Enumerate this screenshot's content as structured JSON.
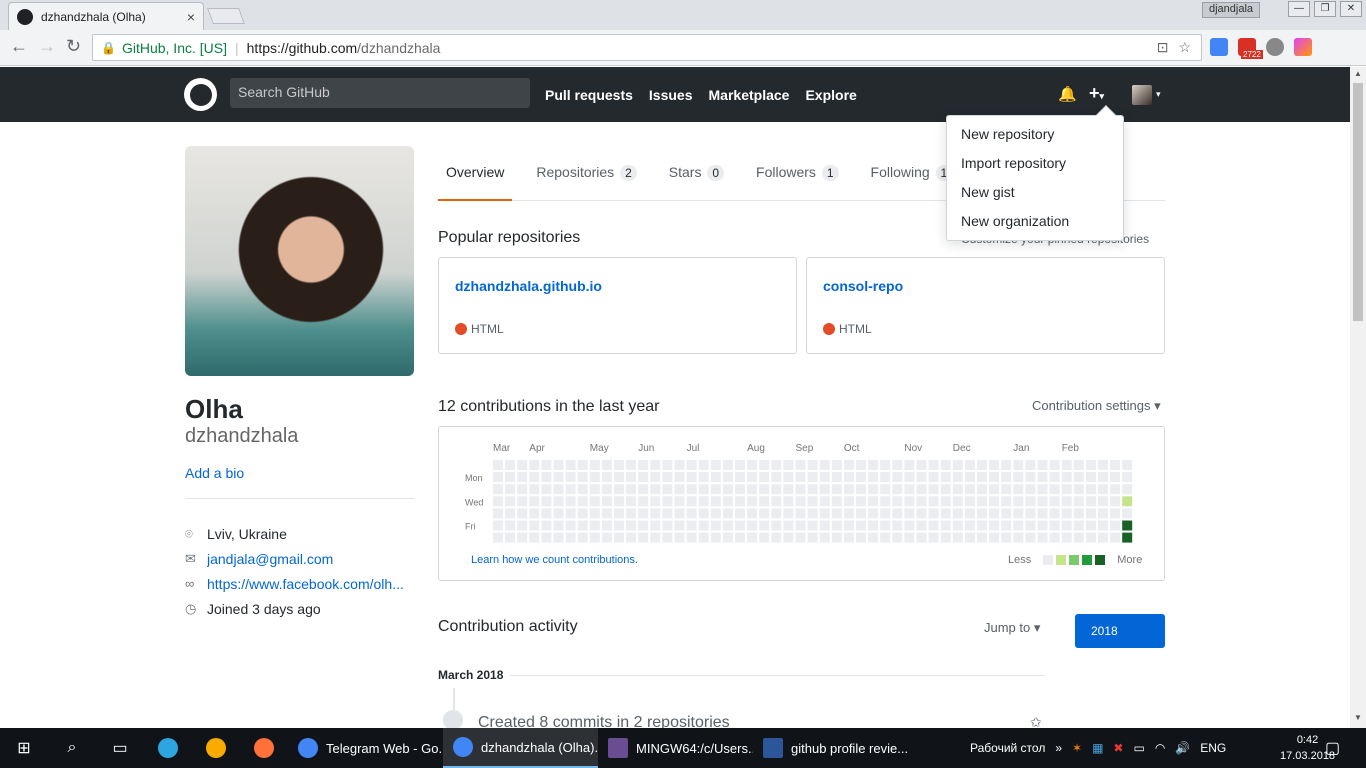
{
  "browser": {
    "tab_title": "dzhandzhala (Olha)",
    "tab_close": "×",
    "window_user": "djandjala",
    "secure_label": "GitHub, Inc. [US]",
    "url_host": "https://github.com",
    "url_path": "/dzhandzhala",
    "ext_badge": "2722"
  },
  "header": {
    "search_placeholder": "Search GitHub",
    "nav": [
      "Pull requests",
      "Issues",
      "Marketplace",
      "Explore"
    ]
  },
  "dropdown": {
    "items": [
      "New repository",
      "Import repository",
      "New gist",
      "New organization"
    ]
  },
  "profile": {
    "name": "Olha",
    "login": "dzhandzhala",
    "add_bio": "Add a bio",
    "location": "Lviv, Ukraine",
    "email": "jandjala@gmail.com",
    "website": "https://www.facebook.com/olh...",
    "joined": "Joined 3 days ago"
  },
  "tabs": [
    {
      "label": "Overview",
      "count": ""
    },
    {
      "label": "Repositories",
      "count": "2"
    },
    {
      "label": "Stars",
      "count": "0"
    },
    {
      "label": "Followers",
      "count": "1"
    },
    {
      "label": "Following",
      "count": "1"
    }
  ],
  "popular": {
    "title": "Popular repositories",
    "customize": "Customize your pinned repositories",
    "repos": [
      {
        "name": "dzhandzhala.github.io",
        "language": "HTML",
        "lang_color": "#e34c26"
      },
      {
        "name": "consol-repo",
        "language": "HTML",
        "lang_color": "#e34c26"
      }
    ]
  },
  "contributions": {
    "title": "12 contributions in the last year",
    "settings": "Contribution settings ▾",
    "months": [
      "Mar",
      "Apr",
      "May",
      "Jun",
      "Jul",
      "Aug",
      "Sep",
      "Oct",
      "Nov",
      "Dec",
      "Jan",
      "Feb"
    ],
    "days": [
      "Mon",
      "Wed",
      "Fri"
    ],
    "learn": "Learn how we count contributions.",
    "less": "Less",
    "more": "More",
    "colors": [
      "#ebedf0",
      "#c6e48b",
      "#7bc96f",
      "#239a3b",
      "#196127"
    ],
    "active_cells": [
      {
        "week": 52,
        "day": 3,
        "level": 1
      },
      {
        "week": 52,
        "day": 5,
        "level": 4
      },
      {
        "week": 52,
        "day": 6,
        "level": 4
      }
    ]
  },
  "activity": {
    "title": "Contribution activity",
    "jump_to": "Jump to ▾",
    "year": "2018",
    "month": "March 2018",
    "created": "Created 8 commits in 2 repositories"
  },
  "taskbar": {
    "apps": [
      {
        "label": "Telegram Web - Go...",
        "color": "#4285f4"
      },
      {
        "label": "dzhandzhala (Olha)...",
        "color": "#4285f4",
        "active": true
      },
      {
        "label": "MINGW64:/c/Users...",
        "color": "#6a4c93"
      },
      {
        "label": "github profile revie...",
        "color": "#2b579a"
      }
    ],
    "desktop": "Рабочий стол",
    "lang": "ENG",
    "time": "0:42",
    "date": "17.03.2018"
  }
}
